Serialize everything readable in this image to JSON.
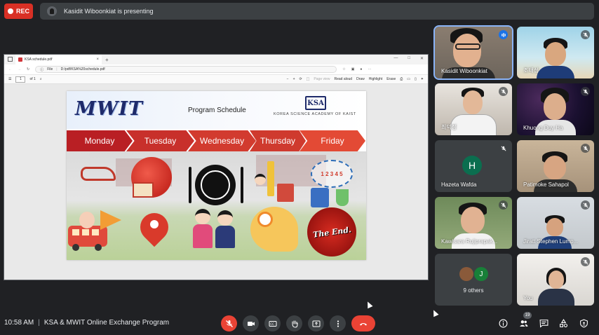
{
  "recording": {
    "label": "REC"
  },
  "presenting": {
    "text": "Kasidit Wiboonkiat is presenting"
  },
  "browser": {
    "tab_title": "KSA schedule.pdf",
    "tab_close": "×",
    "new_tab": "+",
    "win_min": "—",
    "win_max": "□",
    "win_close": "✕",
    "address_prefix": "File",
    "address_url": "D:/pdf/KSA%20schedule.pdf"
  },
  "pdf_toolbar": {
    "page_current": "1",
    "page_total": "of 1",
    "zoom_out": "−",
    "zoom_in": "+",
    "page_view": "Page view",
    "read_aloud": "Read aloud",
    "draw": "Draw",
    "highlight": "Highlight",
    "erase": "Erase"
  },
  "slide": {
    "mwit_logo": "MWIT",
    "program_title": "Program Schedule",
    "ksa_logo": "KSA",
    "ksa_name": "KOREA SCIENCE ACADEMY OF KAIST",
    "days": [
      "Monday",
      "Tuesday",
      "Wednesday",
      "Thursday",
      "Friday"
    ],
    "day_colors": [
      "#b91f24",
      "#c8302b",
      "#d23b2f",
      "#cf3a2e",
      "#e34a35"
    ],
    "math_text": "1 2 3 4 5",
    "end_text": "The End."
  },
  "participants": [
    {
      "name": "Kasidit Wiboonkiat",
      "mic": "speaking"
    },
    {
      "name": "조태성",
      "mic": "muted"
    },
    {
      "name": "최덕정",
      "mic": "muted"
    },
    {
      "name": "Khuong Duy Ha",
      "mic": "muted"
    },
    {
      "name": "Hazeta Wafda",
      "mic": "muted",
      "avatar_letter": "H",
      "avatar_color": "#0b6e4f"
    },
    {
      "name": "Patimoke Sahapol",
      "mic": "muted"
    },
    {
      "name": "Kawisara Rujiprapak...",
      "mic": "muted"
    },
    {
      "name": "Jiratt Stephen Lump...",
      "mic": "muted"
    },
    {
      "name": "9 others",
      "avatar_letter": "J",
      "avatar_color": "#188038"
    },
    {
      "name": "You",
      "mic": "muted"
    }
  ],
  "bottom": {
    "time": "10:58 AM",
    "separator": "|",
    "meeting_title": "KSA & MWIT Online Exchange Program",
    "people_count": "19"
  },
  "colors": {
    "background": "#202124",
    "panel": "#3c4043",
    "danger": "#ea4335",
    "accent": "#1a73e8"
  }
}
